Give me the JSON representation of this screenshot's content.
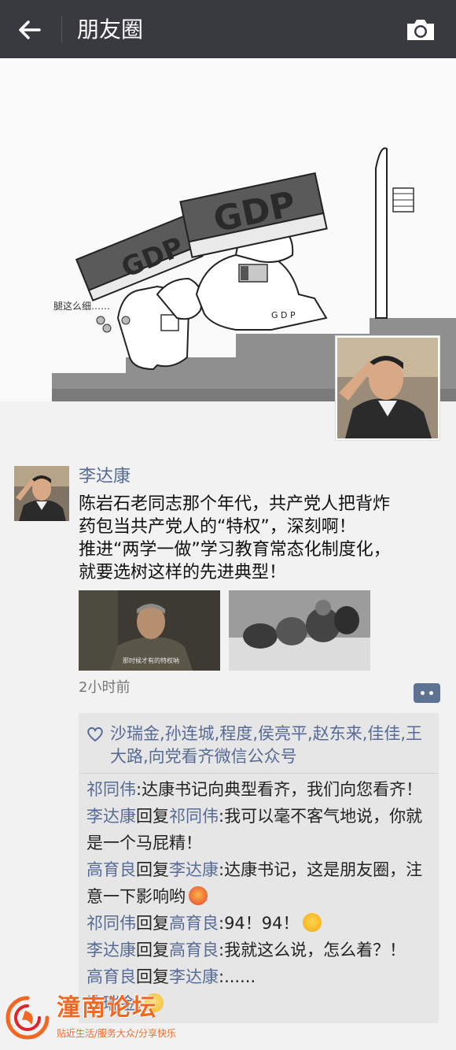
{
  "header": {
    "back_icon": "arrow-left-icon",
    "title": "朋友圈",
    "camera_icon": "camera-icon"
  },
  "cover": {
    "gdp_small": "GDP",
    "gdp_large": "GDP",
    "label": "腿这么细……"
  },
  "post": {
    "author": "李达康",
    "text_lines": [
      "陈岩石老同志那个年代，共产党人把背炸",
      "药包当共产党人的“特权”，深刻啊！",
      "推进“两学一做”学习教育常态化制度化，",
      "就要选树这样的先进典型！"
    ],
    "photo_caption": "那时候才有的特权呐",
    "time": "2小时前"
  },
  "likes": {
    "icon": "heart-outline-icon",
    "names": "沙瑞金,孙连城,程度,侯亮平,赵东来,佳佳,王大路,向党看齐微信公众号"
  },
  "comments": [
    {
      "from": "祁同伟",
      "to": "",
      "text": ":达康书记向典型看齐，我们向您看齐！"
    },
    {
      "from": "李达康",
      "to": "祁同伟",
      "text": ":我可以毫不客气地说，你就是一个马屁精！"
    },
    {
      "from": "高育良",
      "to": "李达康",
      "text": ":达康书记，这是朋友圈，注意一下影响哟",
      "emoji": "flushed-emoji-icon"
    },
    {
      "from": "祁同伟",
      "to": "高育良",
      "text": ":94！94！",
      "emoji": "crying-laughing-emoji-icon"
    },
    {
      "from": "李达康",
      "to": "高育良",
      "text": ":我就这么说，怎么着？！"
    },
    {
      "from": "高育良",
      "to": "李达康",
      "text": ":......"
    },
    {
      "from": "沙瑞金",
      "to": "",
      "text": ":",
      "emoji": "smiling-emoji-icon"
    }
  ],
  "reply_word": "回复",
  "watermark": {
    "title": "潼南论坛",
    "subtitle": "贴近生活/服务大众/分享快乐"
  },
  "colors": {
    "topbar": "#393a3f",
    "link": "#576b95",
    "comment_bg": "#e6e6e6",
    "watermark": "#f26722"
  }
}
